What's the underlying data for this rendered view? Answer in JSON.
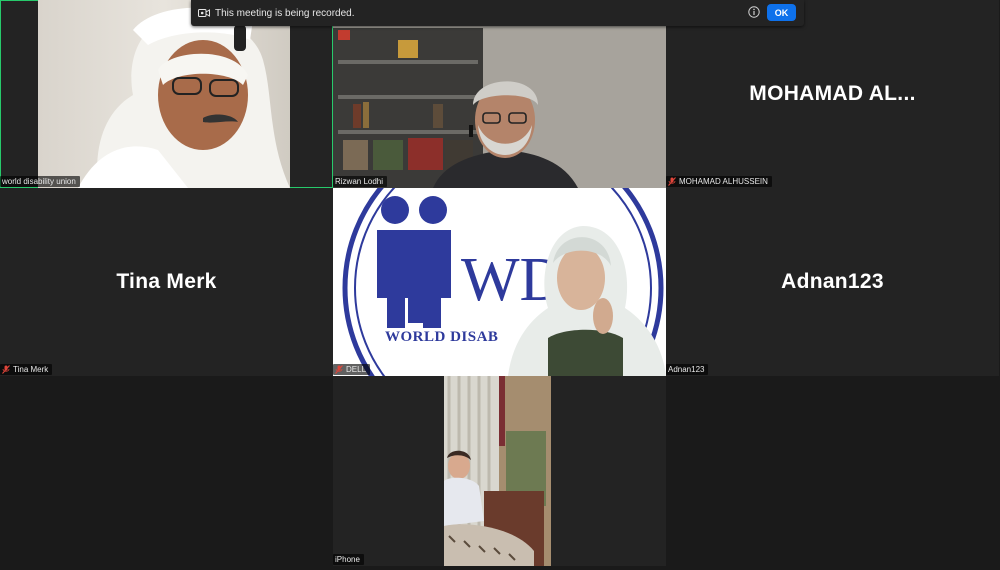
{
  "banner": {
    "message": "This meeting is being recorded.",
    "ok_label": "OK",
    "accent_color": "#0e71eb"
  },
  "participants": [
    {
      "id": "p1",
      "display_name": "world disability union",
      "video_on": true,
      "muted": false,
      "active_speaker": true
    },
    {
      "id": "p2",
      "display_name": "Rizwan Lodhi",
      "video_on": true,
      "muted": false,
      "active_speaker": false
    },
    {
      "id": "p3",
      "display_name": "MOHAMAD ALHUSSEIN",
      "big_name": "MOHAMAD  AL...",
      "video_on": false,
      "muted": true,
      "active_speaker": false
    },
    {
      "id": "p4",
      "display_name": "Tina Merk",
      "big_name": "Tina Merk",
      "video_on": false,
      "muted": true,
      "active_speaker": false
    },
    {
      "id": "p5",
      "display_name": "DELL",
      "video_on": true,
      "muted": true,
      "active_speaker": false,
      "background_text": "WORLD DISAB"
    },
    {
      "id": "p6",
      "display_name": "Adnan123",
      "big_name": "Adnan123",
      "video_on": false,
      "muted": false,
      "active_speaker": false
    },
    {
      "id": "p7",
      "display_name": "iPhone",
      "video_on": true,
      "muted": false,
      "active_speaker": false
    }
  ],
  "icons": {
    "recording": "recording-camera-icon",
    "info": "info-circle-icon",
    "muted": "muted-mic-icon"
  },
  "colors": {
    "active_speaker_border": "#27c96b",
    "muted_mic": "#e0453a",
    "tile_background": "#232323",
    "wdu_logo_blue": "#2e3a9c"
  }
}
